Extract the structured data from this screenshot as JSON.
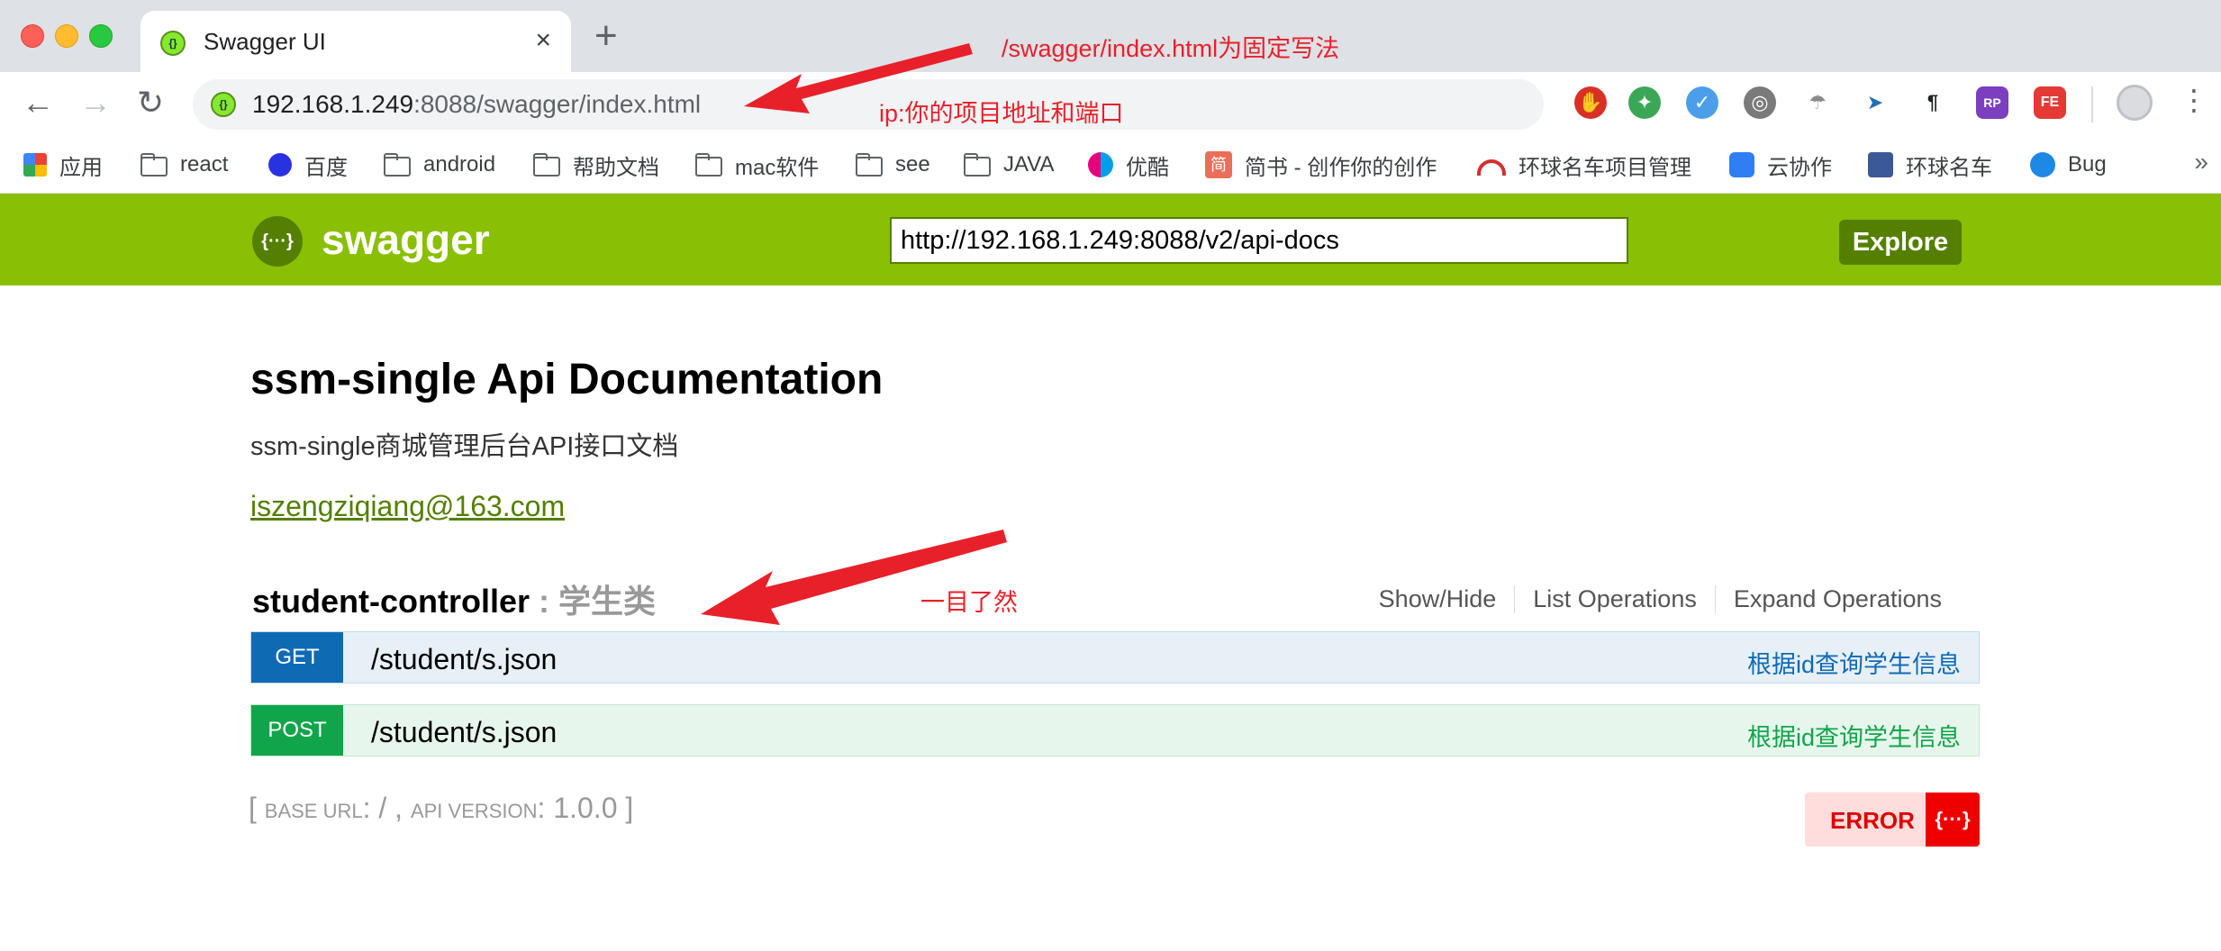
{
  "browser": {
    "tab_title": "Swagger UI",
    "tab_close": "×",
    "new_tab": "+",
    "nav_back": "←",
    "nav_forward": "→",
    "nav_reload": "↻",
    "url_host": "192.168.1.249",
    "url_rest": ":8088/swagger/index.html",
    "menu": "⋮",
    "bookmarks": [
      {
        "label": "应用",
        "icon": "apps-grid-icon"
      },
      {
        "label": "react",
        "icon": "folder-icon"
      },
      {
        "label": "百度",
        "icon": "baidu-paw-icon"
      },
      {
        "label": "android",
        "icon": "folder-icon"
      },
      {
        "label": "帮助文档",
        "icon": "folder-icon"
      },
      {
        "label": "mac软件",
        "icon": "folder-icon"
      },
      {
        "label": "see",
        "icon": "folder-icon"
      },
      {
        "label": "JAVA",
        "icon": "folder-icon"
      },
      {
        "label": "优酷",
        "icon": "youku-icon"
      },
      {
        "label": "简书 - 创作你的创作",
        "icon": "jianshu-icon"
      },
      {
        "label": "环球名车项目管理",
        "icon": "project-icon"
      },
      {
        "label": "云协作",
        "icon": "cloud-collab-icon"
      },
      {
        "label": "环球名车",
        "icon": "site-icon"
      },
      {
        "label": "Bug",
        "icon": "bird-icon"
      }
    ],
    "bookmarks_more": "»"
  },
  "swagger": {
    "logo_text": "swagger",
    "logo_icon": "{···}",
    "api_url": "http://192.168.1.249:8088/v2/api-docs",
    "explore_label": "Explore",
    "title": "ssm-single Api Documentation",
    "description": "ssm-single商城管理后台API接口文档",
    "contact": "iszengziqiang@163.com",
    "controller": {
      "name": "student-controller",
      "separator": " : ",
      "description": "学生类",
      "actions": [
        "Show/Hide",
        "List Operations",
        "Expand Operations"
      ]
    },
    "operations": [
      {
        "method": "GET",
        "path": "/student/s.json",
        "summary": "根据id查询学生信息"
      },
      {
        "method": "POST",
        "path": "/student/s.json",
        "summary": "根据id查询学生信息"
      }
    ],
    "footer": {
      "open": "[ ",
      "base_url_label": "base url",
      "base_url_value": ": / , ",
      "api_version_label": "api version",
      "api_version_value": ": 1.0.0",
      "close": " ]"
    },
    "error_label": "ERROR",
    "error_icon": "{···}"
  },
  "annotations": {
    "note_url": "/swagger/index.html为固定写法",
    "note_ip": "ip:你的项目地址和端口",
    "note_controller": "一目了然",
    "arrow_color": "#e8202a"
  },
  "colors": {
    "swagger_green": "#89bf04",
    "swagger_dark_green": "#547f00",
    "get_blue": "#0f6ab4",
    "post_green": "#10a54a",
    "error_red": "#ee0000"
  }
}
